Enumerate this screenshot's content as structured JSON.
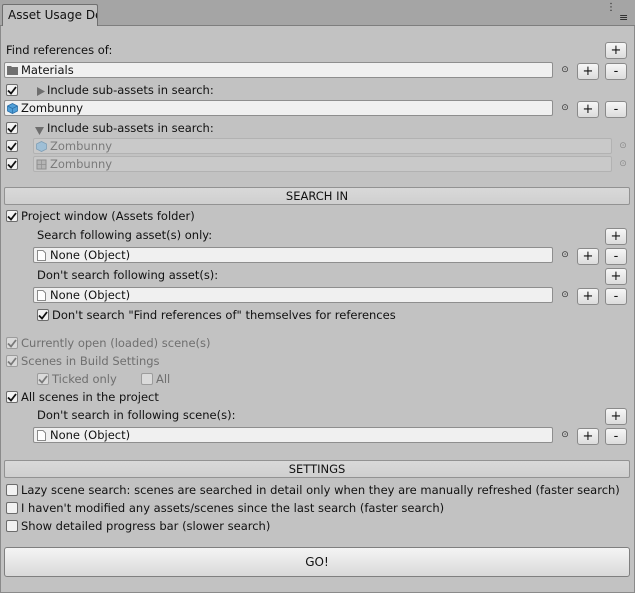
{
  "window": {
    "tab_title": "Asset Usage De",
    "controls": {
      "more": "⋮",
      "menu": "≡"
    }
  },
  "find_refs": {
    "label": "Find references of:",
    "items": [
      {
        "name": "Materials",
        "icon": "folder-icon",
        "include_subassets_label": "Include sub-assets in search:",
        "expanded": false
      },
      {
        "name": "Zombunny",
        "icon": "prefab-icon",
        "include_subassets_label": "Include sub-assets in search:",
        "expanded": true,
        "subassets": [
          {
            "name": "Zombunny",
            "icon": "prefab-icon"
          },
          {
            "name": "Zombunny",
            "icon": "mesh-icon"
          }
        ]
      }
    ]
  },
  "search_in": {
    "header": "SEARCH IN",
    "project_window_label": "Project window (Assets folder)",
    "search_only_label": "Search following asset(s) only:",
    "search_only_value": "None (Object)",
    "dont_search_label": "Don't search following asset(s):",
    "dont_search_value": "None (Object)",
    "dont_search_self_label": "Don't search \"Find references of\" themselves for references",
    "open_scenes_label": "Currently open (loaded) scene(s)",
    "build_scenes_label": "Scenes in Build Settings",
    "ticked_only_label": "Ticked only",
    "all_label": "All",
    "all_scenes_label": "All scenes in the project",
    "dont_search_scenes_label": "Don't search in following scene(s):",
    "dont_search_scenes_value": "None (Object)"
  },
  "settings": {
    "header": "SETTINGS",
    "lazy_label": "Lazy scene search: scenes are searched in detail only when they are manually refreshed (faster search)",
    "not_modified_label": "I haven't modified any assets/scenes since the last search (faster search)",
    "progress_label": "Show detailed progress bar (slower search)"
  },
  "buttons": {
    "plus": "+",
    "minus": "-",
    "go": "GO!"
  },
  "colors": {
    "window_bg": "#c2c2c2",
    "tab_strip": "#a5a5a5",
    "field_bg": "#f0f0f0"
  }
}
